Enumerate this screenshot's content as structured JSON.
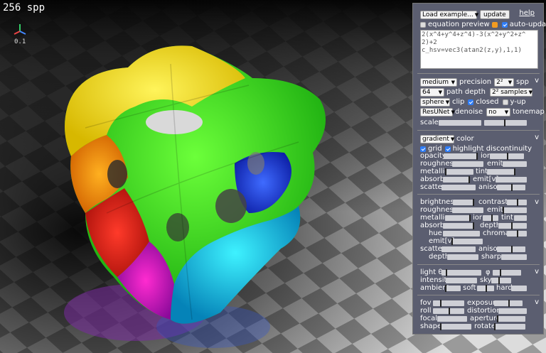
{
  "viewport": {
    "spp_label": "256 spp",
    "axes_scale": "0.1"
  },
  "panel": {
    "top": {
      "load_example": "Load example...",
      "update": "update",
      "help": "help",
      "equation_preview": "equation preview",
      "auto_update": "auto-update",
      "equation_line1": "2(x^4+y^4+z^4)-3(x^2+y^2+z^",
      "equation_line2": "2)+2",
      "equation_line3": "c_hsv=vec3(atan2(z,y),1,1)"
    },
    "render": {
      "precision_value": "medium",
      "precision_label": "precision",
      "spp_value": "2²",
      "spp_label": "spp",
      "path_depth_value": "64",
      "path_depth_label": "path depth",
      "samples_value": "2² samples",
      "clip_value": "sphere",
      "clip_label": "clip",
      "closed_label": "closed",
      "yup_label": "y-up",
      "denoise_value": "ResUNet",
      "denoise_label": "denoise",
      "tonemap_value": "no",
      "tonemap_label": "tonemap",
      "scale_label": "scale",
      "collapse": "v"
    },
    "material": {
      "color_mode": "gradient",
      "color_label": "color",
      "grid_label": "grid",
      "highlight_label": "highlight discontinuity",
      "opacity": "opacity",
      "ior": "ior",
      "roughness": "roughness",
      "emit": "emit",
      "metallic": "metallic",
      "tint": "tint",
      "absorb": "absorb",
      "emitv": "emit[v]",
      "scatter": "scatter",
      "aniso": "aniso",
      "collapse": "v"
    },
    "surface": {
      "brightness": "brightness",
      "contrast": "contrast",
      "roughness": "roughness",
      "emit": "emit",
      "metallic": "metallic",
      "ior": "ior",
      "tint": "tint",
      "absorb": "absorb",
      "depth": "depth",
      "hue": "hue",
      "chroma": "chroma",
      "emitv": "emit[v]",
      "scatter": "scatter",
      "aniso": "aniso",
      "depth2": "depth",
      "sharp": "sharp",
      "collapse": "v"
    },
    "light": {
      "theta": "light θ",
      "phi": "φ",
      "intensity": "intensity",
      "sky": "sky",
      "ambient": "ambient",
      "soft": "soft",
      "hard": "hard",
      "collapse": "v"
    },
    "camera": {
      "fov": "fov",
      "exposure": "exposure",
      "roll": "roll",
      "distortion": "distortion",
      "focal": "focal",
      "aperture": "aperture",
      "shape": "shape",
      "rotate": "rotate",
      "collapse": "v"
    }
  },
  "colors": {
    "panel_bg": "#5b5e70",
    "checkbox_on": "#2f7df6",
    "checkbox_orange": "#f29b21"
  }
}
